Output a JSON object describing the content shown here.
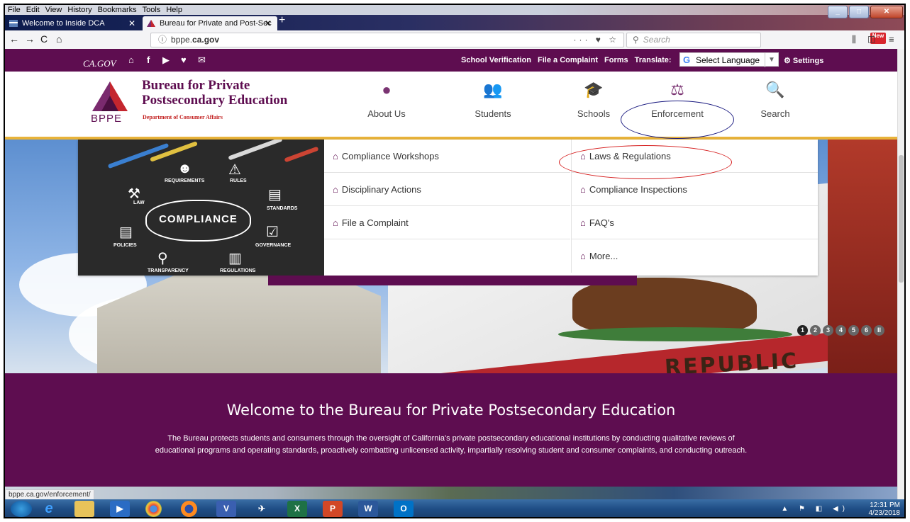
{
  "browser": {
    "menu": [
      "File",
      "Edit",
      "View",
      "History",
      "Bookmarks",
      "Tools",
      "Help"
    ],
    "tabs": [
      {
        "label": "Welcome to Inside DCA",
        "active": false
      },
      {
        "label": "Bureau for Private and Post-Sec",
        "active": true
      }
    ],
    "url_prefix": "bppe.",
    "url_domain": "ca.gov",
    "search_placeholder": "Search",
    "page_actions": "··· ♥ ☆",
    "new_badge": "New",
    "status_url": "bppe.ca.gov/enforcement/"
  },
  "site": {
    "ca_gov": "CA.GOV",
    "top_links": [
      "School Verification",
      "File a Complaint",
      "Forms",
      "Translate:"
    ],
    "language_select": "Select Language",
    "settings": "Settings",
    "brand": {
      "abbr": "BPPE",
      "name_line1": "Bureau for Private",
      "name_line2": "Postsecondary Education",
      "department": "Department of Consumer Affairs"
    },
    "nav": [
      {
        "label": "About Us",
        "icon": "info-icon"
      },
      {
        "label": "Students",
        "icon": "users-icon"
      },
      {
        "label": "Schools",
        "icon": "graduation-cap-icon"
      },
      {
        "label": "Enforcement",
        "icon": "scales-icon"
      },
      {
        "label": "Search",
        "icon": "search-icon"
      }
    ],
    "dropdown": {
      "image_labels": {
        "center": "COMPLIANCE",
        "requirements": "REQUIREMENTS",
        "rules": "RULES",
        "law": "LAW",
        "standards": "STANDARDS",
        "policies": "POLICIES",
        "governance": "GOVERNANCE",
        "transparency": "TRANSPARENCY",
        "regulations": "REGULATIONS"
      },
      "col1": [
        "Compliance Workshops",
        "Disciplinary Actions",
        "File a Complaint"
      ],
      "col2": [
        "Laws & Regulations",
        "Compliance Inspections",
        "FAQ's",
        "More..."
      ]
    },
    "hero": {
      "flag_text": "REPUBLIC",
      "slides": [
        "1",
        "2",
        "3",
        "4",
        "5",
        "6",
        "II"
      ]
    },
    "welcome": {
      "title": "Welcome to the Bureau for Private Postsecondary Education",
      "text": "The Bureau protects students and consumers through the oversight of California's private postsecondary educational institutions by conducting qualitative reviews of educational programs and operating standards, proactively combatting unlicensed activity, impartially resolving student and consumer complaints, and conducting outreach."
    }
  },
  "taskbar": {
    "apps": [
      "start-orb",
      "internet-explorer",
      "file-explorer",
      "media-player",
      "chrome",
      "firefox",
      "visio",
      "pin-app",
      "excel",
      "powerpoint",
      "word",
      "outlook"
    ],
    "app_labels": [
      "",
      "e",
      "",
      "▶",
      "",
      "",
      "V",
      "✈",
      "X",
      "P",
      "W",
      "O"
    ],
    "time": "12:31 PM",
    "date": "4/23/2018"
  },
  "colors": {
    "brand_purple": "#5e0d50",
    "gold_accent": "#e8b33a",
    "enforcement_annotation": "#1a1a80",
    "laws_annotation": "#d51a1a"
  }
}
